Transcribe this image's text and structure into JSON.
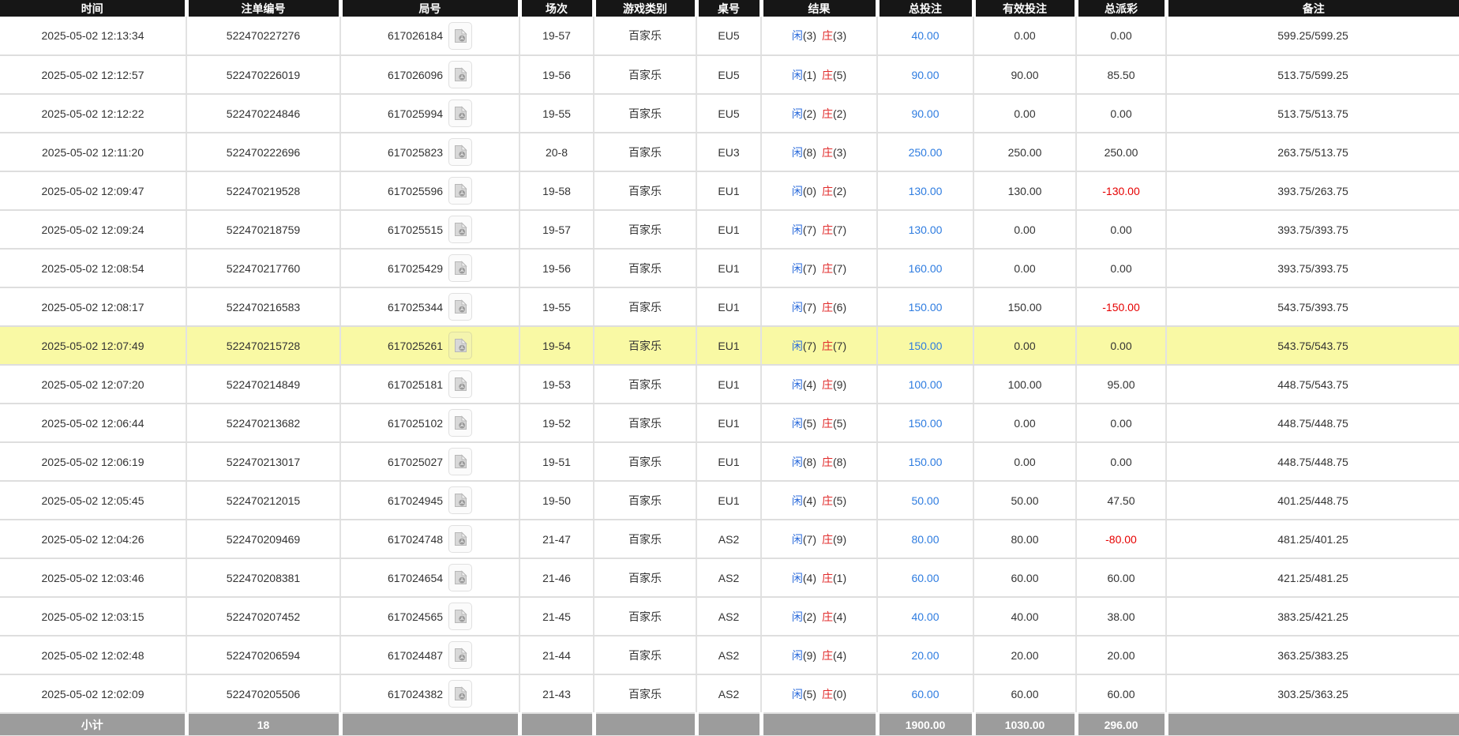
{
  "colors": {
    "header_bg": "#161616",
    "footer_bg": "#9c9c9c",
    "highlight_row": "#f9f9a4",
    "player_blue": "#2b6bdb",
    "banker_red": "#e02b2b",
    "amount_blue": "#2e7ce0",
    "negative_red": "#e60000"
  },
  "table": {
    "columns": [
      {
        "key": "time",
        "label": "时间"
      },
      {
        "key": "bet_no",
        "label": "注单编号"
      },
      {
        "key": "round_no",
        "label": "局号"
      },
      {
        "key": "session",
        "label": "场次"
      },
      {
        "key": "game_type",
        "label": "游戏类别"
      },
      {
        "key": "table_no",
        "label": "桌号"
      },
      {
        "key": "result",
        "label": "结果"
      },
      {
        "key": "total_bet",
        "label": "总投注"
      },
      {
        "key": "valid_bet",
        "label": "有效投注"
      },
      {
        "key": "payout",
        "label": "总派彩"
      },
      {
        "key": "remark",
        "label": "备注"
      }
    ],
    "result_labels": {
      "player": "闲",
      "banker": "庄"
    },
    "video_icon": "video-file-icon",
    "highlighted_row_index": 8,
    "rows": [
      {
        "time": "2025-05-02 12:13:34",
        "bet_no": "522470227276",
        "round_no": "617026184",
        "session": "19-57",
        "game_type": "百家乐",
        "table_no": "EU5",
        "player_score": "(3)",
        "banker_score": "(3)",
        "total_bet": "40.00",
        "valid_bet": "0.00",
        "payout": "0.00",
        "remark": "599.25/599.25"
      },
      {
        "time": "2025-05-02 12:12:57",
        "bet_no": "522470226019",
        "round_no": "617026096",
        "session": "19-56",
        "game_type": "百家乐",
        "table_no": "EU5",
        "player_score": "(1)",
        "banker_score": "(5)",
        "total_bet": "90.00",
        "valid_bet": "90.00",
        "payout": "85.50",
        "remark": "513.75/599.25"
      },
      {
        "time": "2025-05-02 12:12:22",
        "bet_no": "522470224846",
        "round_no": "617025994",
        "session": "19-55",
        "game_type": "百家乐",
        "table_no": "EU5",
        "player_score": "(2)",
        "banker_score": "(2)",
        "total_bet": "90.00",
        "valid_bet": "0.00",
        "payout": "0.00",
        "remark": "513.75/513.75"
      },
      {
        "time": "2025-05-02 12:11:20",
        "bet_no": "522470222696",
        "round_no": "617025823",
        "session": "20-8",
        "game_type": "百家乐",
        "table_no": "EU3",
        "player_score": "(8)",
        "banker_score": "(3)",
        "total_bet": "250.00",
        "valid_bet": "250.00",
        "payout": "250.00",
        "remark": "263.75/513.75"
      },
      {
        "time": "2025-05-02 12:09:47",
        "bet_no": "522470219528",
        "round_no": "617025596",
        "session": "19-58",
        "game_type": "百家乐",
        "table_no": "EU1",
        "player_score": "(0)",
        "banker_score": "(2)",
        "total_bet": "130.00",
        "valid_bet": "130.00",
        "payout": "-130.00",
        "remark": "393.75/263.75"
      },
      {
        "time": "2025-05-02 12:09:24",
        "bet_no": "522470218759",
        "round_no": "617025515",
        "session": "19-57",
        "game_type": "百家乐",
        "table_no": "EU1",
        "player_score": "(7)",
        "banker_score": "(7)",
        "total_bet": "130.00",
        "valid_bet": "0.00",
        "payout": "0.00",
        "remark": "393.75/393.75"
      },
      {
        "time": "2025-05-02 12:08:54",
        "bet_no": "522470217760",
        "round_no": "617025429",
        "session": "19-56",
        "game_type": "百家乐",
        "table_no": "EU1",
        "player_score": "(7)",
        "banker_score": "(7)",
        "total_bet": "160.00",
        "valid_bet": "0.00",
        "payout": "0.00",
        "remark": "393.75/393.75"
      },
      {
        "time": "2025-05-02 12:08:17",
        "bet_no": "522470216583",
        "round_no": "617025344",
        "session": "19-55",
        "game_type": "百家乐",
        "table_no": "EU1",
        "player_score": "(7)",
        "banker_score": "(6)",
        "total_bet": "150.00",
        "valid_bet": "150.00",
        "payout": "-150.00",
        "remark": "543.75/393.75"
      },
      {
        "time": "2025-05-02 12:07:49",
        "bet_no": "522470215728",
        "round_no": "617025261",
        "session": "19-54",
        "game_type": "百家乐",
        "table_no": "EU1",
        "player_score": "(7)",
        "banker_score": "(7)",
        "total_bet": "150.00",
        "valid_bet": "0.00",
        "payout": "0.00",
        "remark": "543.75/543.75"
      },
      {
        "time": "2025-05-02 12:07:20",
        "bet_no": "522470214849",
        "round_no": "617025181",
        "session": "19-53",
        "game_type": "百家乐",
        "table_no": "EU1",
        "player_score": "(4)",
        "banker_score": "(9)",
        "total_bet": "100.00",
        "valid_bet": "100.00",
        "payout": "95.00",
        "remark": "448.75/543.75"
      },
      {
        "time": "2025-05-02 12:06:44",
        "bet_no": "522470213682",
        "round_no": "617025102",
        "session": "19-52",
        "game_type": "百家乐",
        "table_no": "EU1",
        "player_score": "(5)",
        "banker_score": "(5)",
        "total_bet": "150.00",
        "valid_bet": "0.00",
        "payout": "0.00",
        "remark": "448.75/448.75"
      },
      {
        "time": "2025-05-02 12:06:19",
        "bet_no": "522470213017",
        "round_no": "617025027",
        "session": "19-51",
        "game_type": "百家乐",
        "table_no": "EU1",
        "player_score": "(8)",
        "banker_score": "(8)",
        "total_bet": "150.00",
        "valid_bet": "0.00",
        "payout": "0.00",
        "remark": "448.75/448.75"
      },
      {
        "time": "2025-05-02 12:05:45",
        "bet_no": "522470212015",
        "round_no": "617024945",
        "session": "19-50",
        "game_type": "百家乐",
        "table_no": "EU1",
        "player_score": "(4)",
        "banker_score": "(5)",
        "total_bet": "50.00",
        "valid_bet": "50.00",
        "payout": "47.50",
        "remark": "401.25/448.75"
      },
      {
        "time": "2025-05-02 12:04:26",
        "bet_no": "522470209469",
        "round_no": "617024748",
        "session": "21-47",
        "game_type": "百家乐",
        "table_no": "AS2",
        "player_score": "(7)",
        "banker_score": "(9)",
        "total_bet": "80.00",
        "valid_bet": "80.00",
        "payout": "-80.00",
        "remark": "481.25/401.25"
      },
      {
        "time": "2025-05-02 12:03:46",
        "bet_no": "522470208381",
        "round_no": "617024654",
        "session": "21-46",
        "game_type": "百家乐",
        "table_no": "AS2",
        "player_score": "(4)",
        "banker_score": "(1)",
        "total_bet": "60.00",
        "valid_bet": "60.00",
        "payout": "60.00",
        "remark": "421.25/481.25"
      },
      {
        "time": "2025-05-02 12:03:15",
        "bet_no": "522470207452",
        "round_no": "617024565",
        "session": "21-45",
        "game_type": "百家乐",
        "table_no": "AS2",
        "player_score": "(2)",
        "banker_score": "(4)",
        "total_bet": "40.00",
        "valid_bet": "40.00",
        "payout": "38.00",
        "remark": "383.25/421.25"
      },
      {
        "time": "2025-05-02 12:02:48",
        "bet_no": "522470206594",
        "round_no": "617024487",
        "session": "21-44",
        "game_type": "百家乐",
        "table_no": "AS2",
        "player_score": "(9)",
        "banker_score": "(4)",
        "total_bet": "20.00",
        "valid_bet": "20.00",
        "payout": "20.00",
        "remark": "363.25/383.25"
      },
      {
        "time": "2025-05-02 12:02:09",
        "bet_no": "522470205506",
        "round_no": "617024382",
        "session": "21-43",
        "game_type": "百家乐",
        "table_no": "AS2",
        "player_score": "(5)",
        "banker_score": "(0)",
        "total_bet": "60.00",
        "valid_bet": "60.00",
        "payout": "60.00",
        "remark": "303.25/363.25"
      }
    ],
    "footer": {
      "label": "小计",
      "count": "18",
      "total_bet": "1900.00",
      "valid_bet": "1030.00",
      "payout": "296.00"
    }
  }
}
